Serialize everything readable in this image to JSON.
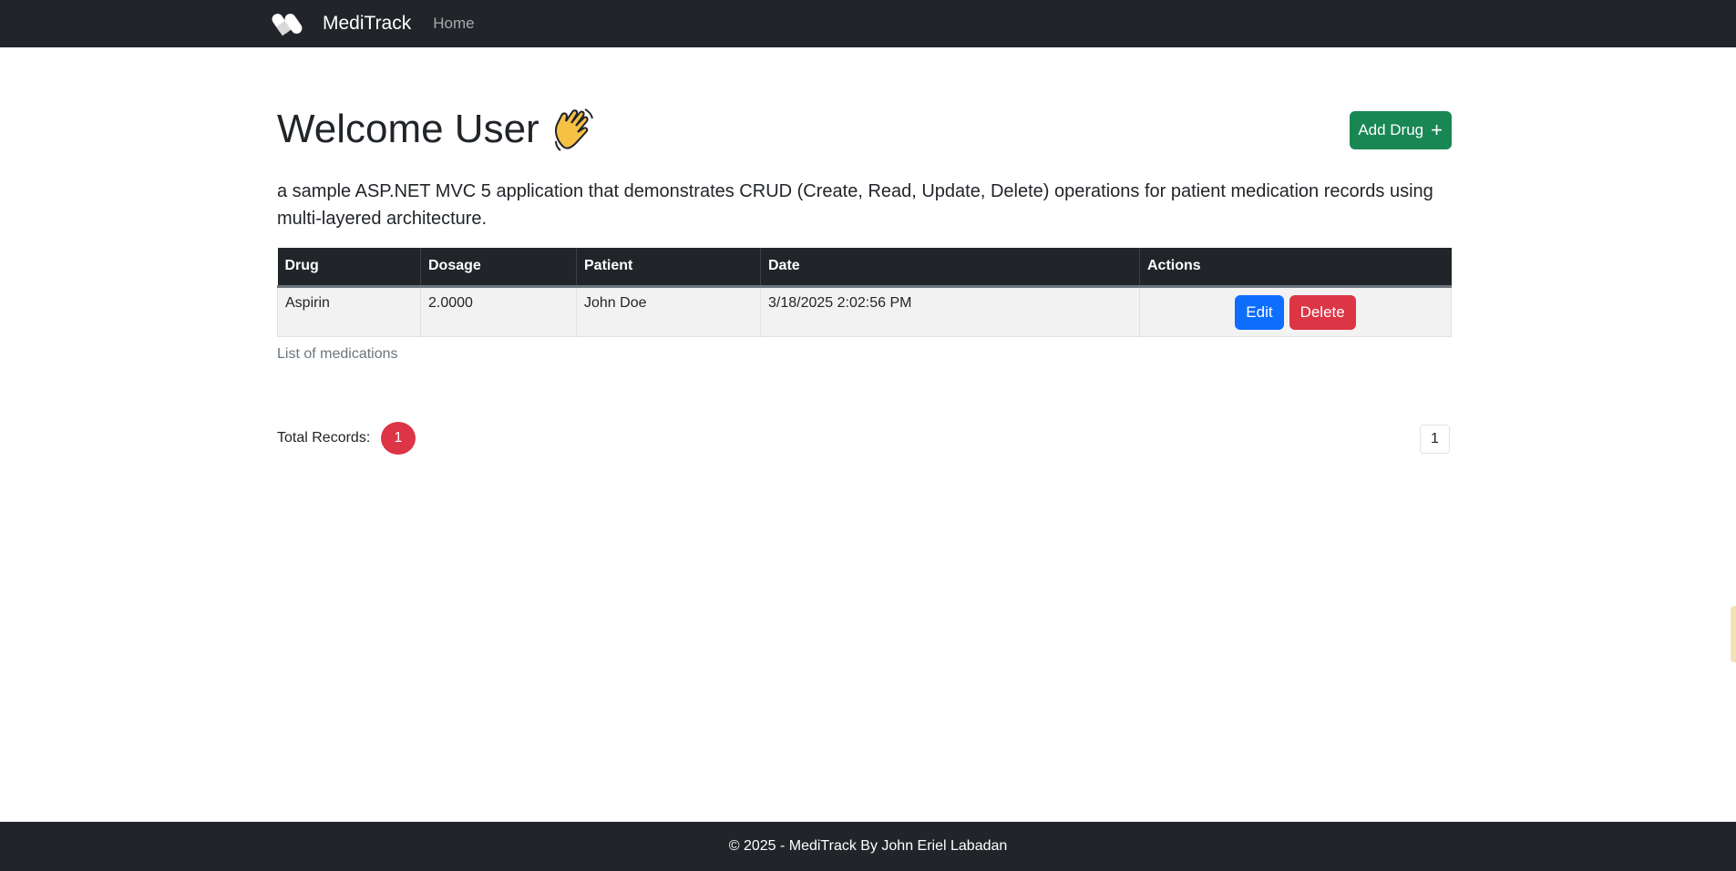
{
  "navbar": {
    "brand": "MediTrack",
    "links": [
      {
        "label": "Home"
      }
    ],
    "logo_icon": "pills-icon"
  },
  "header": {
    "title": "Welcome User",
    "emoji": "waving-hand-icon",
    "add_button": "Add Drug",
    "add_icon": "plus-icon"
  },
  "lead": "a sample ASP.NET MVC 5 application that demonstrates CRUD (Create, Read, Update, Delete) operations for patient medication records using multi-layered architecture.",
  "table": {
    "columns": [
      "Drug",
      "Dosage",
      "Patient",
      "Date",
      "Actions"
    ],
    "rows": [
      {
        "drug": "Aspirin",
        "dosage": "2.0000",
        "patient": "John Doe",
        "date": "3/18/2025 2:02:56 PM",
        "edit": "Edit",
        "delete": "Delete"
      }
    ],
    "caption": "List of medications"
  },
  "summary": {
    "total_label": "Total Records:",
    "total_count": "1",
    "current_page": "1"
  },
  "footer": {
    "text": "© 2025 - MediTrack By John Eriel Labadan"
  },
  "colors": {
    "navbar": "#212529",
    "success": "#198754",
    "primary": "#0d6efd",
    "danger": "#dc3545"
  }
}
